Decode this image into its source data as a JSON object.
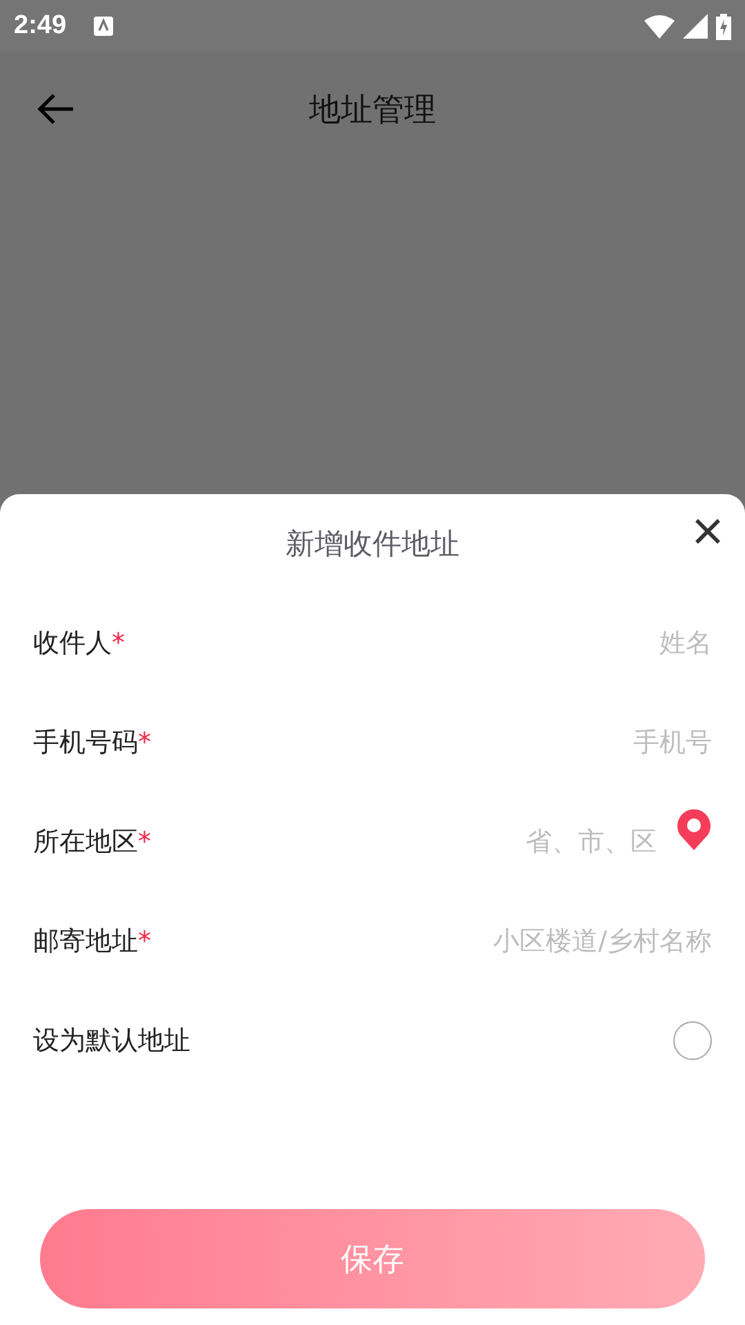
{
  "status_bar": {
    "time": "2:49"
  },
  "header": {
    "title": "地址管理"
  },
  "sheet": {
    "title": "新增收件地址",
    "fields": [
      {
        "kind": "text",
        "label": "收件人",
        "required_mark": "*",
        "placeholder": "姓名"
      },
      {
        "kind": "text",
        "label": "手机号码",
        "required_mark": "*",
        "placeholder": "手机号"
      },
      {
        "kind": "region",
        "label": "所在地区",
        "required_mark": "*",
        "placeholder": "省、市、区"
      },
      {
        "kind": "text",
        "label": "邮寄地址",
        "required_mark": "*",
        "placeholder": "小区楼道/乡村名称"
      }
    ],
    "default_option": {
      "label": "设为默认地址",
      "checked": false
    },
    "save_button": "保存"
  }
}
